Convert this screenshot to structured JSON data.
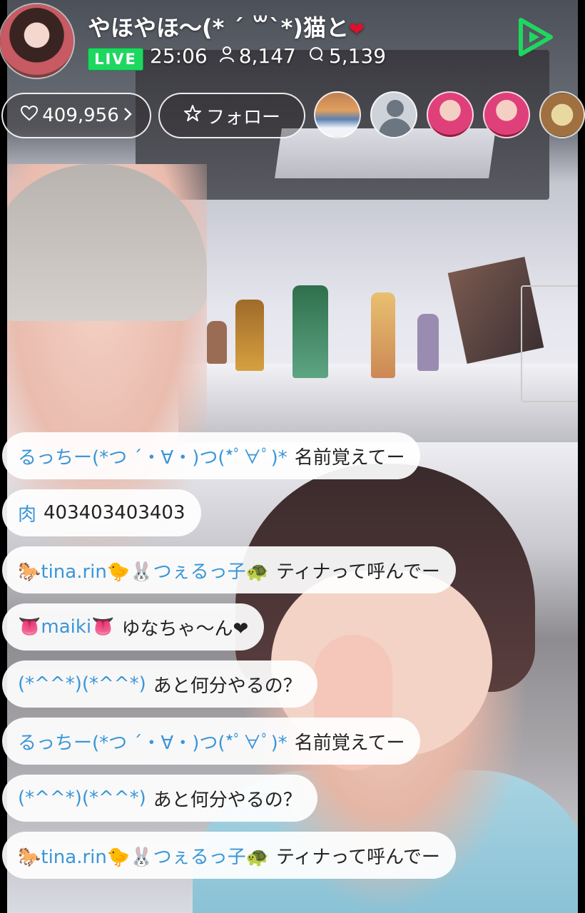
{
  "header": {
    "title": "やほやほ〜(* ´ ꒳`*)猫と",
    "title_heart": "❤",
    "live_label": "LIVE",
    "duration": "25:06",
    "viewers": "8,147",
    "comments_count": "5,139"
  },
  "actions": {
    "likes": "409,956",
    "follow_label": "フォロー"
  },
  "comments": [
    {
      "user": "るっちー(*つ ´・∀・)つ(*ﾟ∀ﾟ)*",
      "message": "名前覚えてー"
    },
    {
      "user": "肉",
      "message": "403403403403"
    },
    {
      "user": "🐎tina.rin🐤🐰つぇるっ子🐢",
      "message": "ティナって呼んでー"
    },
    {
      "user": "👅maiki👅",
      "message": "ゆなちゃ〜ん❤"
    },
    {
      "user": "(*^^*)(*^^*)",
      "message": "あと何分やるの？"
    },
    {
      "user": "るっちー(*つ ´・∀・)つ(*ﾟ∀ﾟ)*",
      "message": "名前覚えてー"
    },
    {
      "user": "(*^^*)(*^^*)",
      "message": "あと何分やるの？"
    },
    {
      "user": "🐎tina.rin🐤🐰つぇるっ子🐢",
      "message": "ティナって呼んでー"
    }
  ],
  "colors": {
    "live_green": "#1ed760",
    "username_blue": "#3a96d8",
    "heart_red": "#e0102a"
  },
  "icons": {
    "viewer": "person-icon",
    "comment": "speech-bubble-icon",
    "like": "heart-icon",
    "follow": "star-icon",
    "play": "play-icon"
  }
}
